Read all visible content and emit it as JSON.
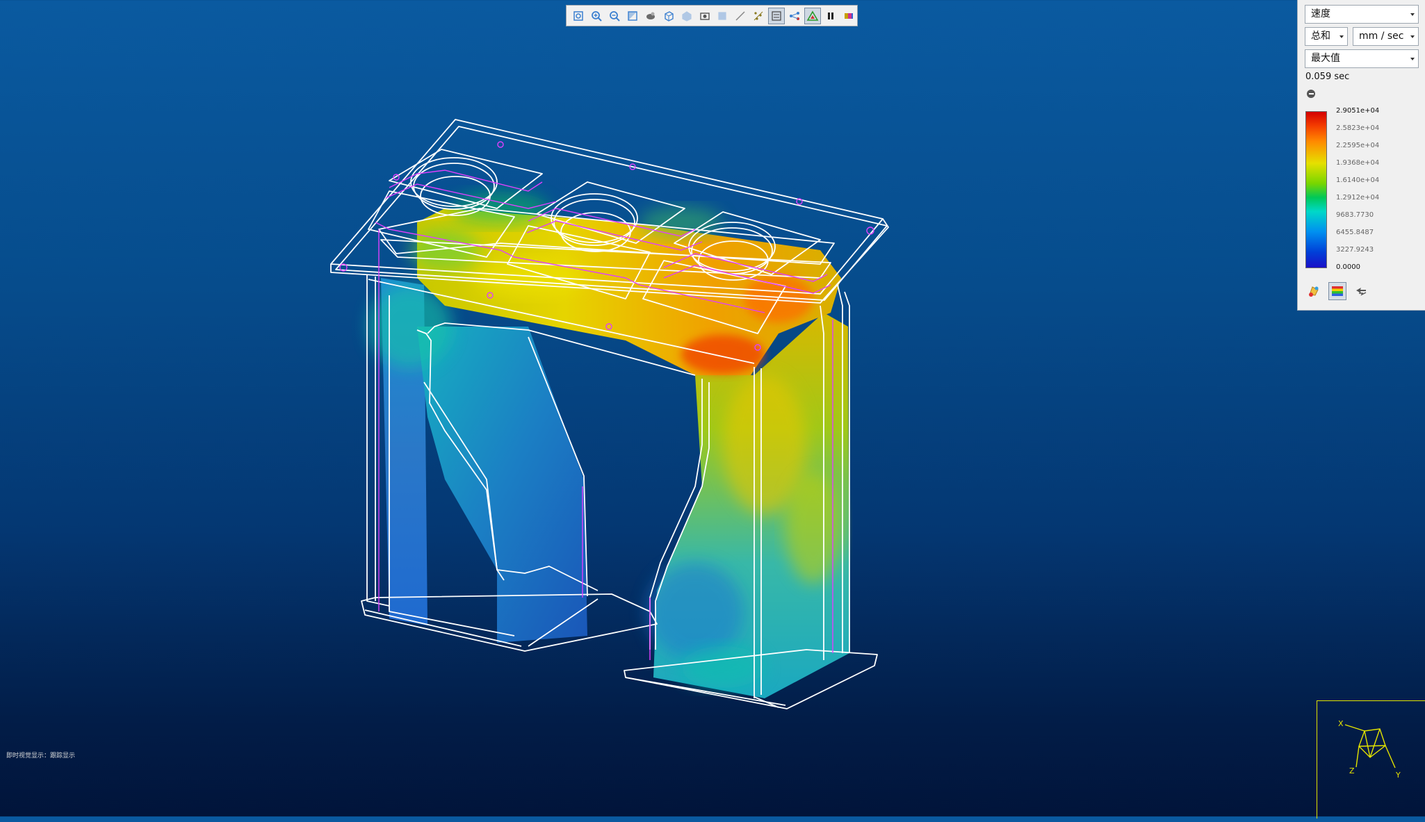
{
  "toolbar": {
    "buttons": [
      {
        "name": "zoom-fit-icon",
        "color": "#3a7fd0",
        "active": false
      },
      {
        "name": "zoom-in-icon",
        "color": "#3a7fd0",
        "active": false
      },
      {
        "name": "zoom-out-icon",
        "color": "#3a7fd0",
        "active": false
      },
      {
        "name": "section-plane-icon",
        "color": "#3a7fd0",
        "active": false
      },
      {
        "name": "render-mode-icon",
        "color": "#6b6b6b",
        "active": false
      },
      {
        "name": "view-cube-icon",
        "color": "#3a7fd0",
        "active": false
      },
      {
        "name": "view-iso-icon",
        "color": "#3a7fd0",
        "active": false
      },
      {
        "name": "capture-icon",
        "color": "#555555",
        "active": false
      },
      {
        "name": "view-box-icon",
        "color": "#3a7fd0",
        "active": false
      },
      {
        "name": "measure-icon",
        "color": "#888888",
        "active": false
      },
      {
        "name": "probe-points-icon",
        "color": "#8a7a20",
        "active": false
      },
      {
        "name": "display-settings-icon",
        "color": "#444444",
        "active": true
      },
      {
        "name": "node-link-icon",
        "color": "#3a7fd0",
        "active": false
      },
      {
        "name": "triangle-mesh-icon",
        "color": "#2a9a2a",
        "active": true
      },
      {
        "name": "pause-icon",
        "color": "#222222",
        "active": false
      },
      {
        "name": "color-legend-icon",
        "color": "#c8a000",
        "active": false
      }
    ]
  },
  "panel": {
    "result_type": "速度",
    "component": "总和",
    "unit": "mm / sec",
    "mode": "最大值",
    "time": "0.059 sec",
    "legend": {
      "labels": [
        "2.9051e+04",
        "2.5823e+04",
        "2.2595e+04",
        "1.9368e+04",
        "1.6140e+04",
        "1.2912e+04",
        "9683.7730",
        "6455.8487",
        "3227.9243",
        "0.0000"
      ]
    }
  },
  "status": {
    "text": "即时视觉显示：跟踪显示"
  },
  "axes": {
    "labels": [
      "X",
      "Y",
      "Z"
    ],
    "color": "#e4e400"
  },
  "colors": {
    "wireframe": "#ffffff",
    "gate_outline": "#e040ff",
    "background_top": "#0a5aa0",
    "background_bottom": "#01143a"
  }
}
